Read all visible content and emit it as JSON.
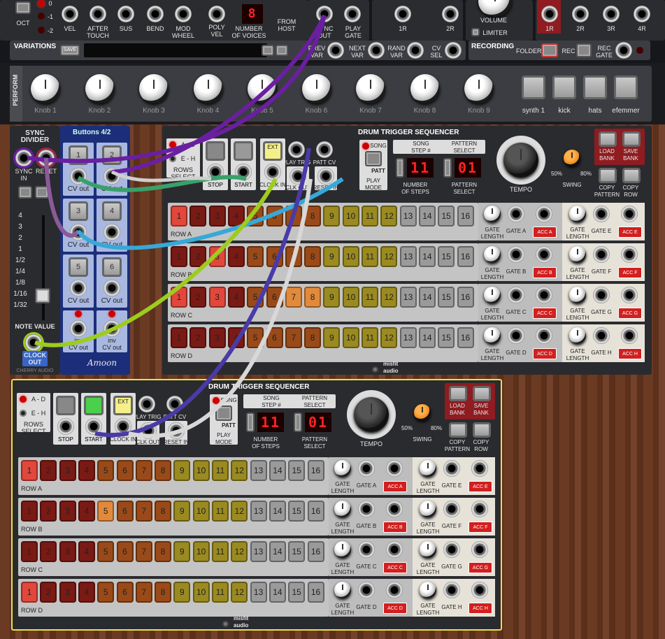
{
  "colors": {
    "cable_purple": "#6a1fa0",
    "cable_green": "#3aa06a",
    "cable_grey": "#cfcfcf",
    "cable_lime": "#9dcc1e",
    "cable_blue": "#37a8d8",
    "cable_indigo": "#4a3aa8",
    "step_red": "#e2473c",
    "step_dark": "#7a1a14",
    "step_brown": "#9a4a18",
    "step_olive": "#9a8a20",
    "step_yellow_lt": "#eee8a8",
    "step_grey": "#9a9a9a",
    "module_yellow_border": "#e8e24a"
  },
  "top": {
    "oct": {
      "label": "OCT",
      "values": [
        "0",
        "-1",
        "-2"
      ]
    },
    "jacks": [
      "VEL",
      "AFTER\nTOUCH",
      "SUS",
      "BEND",
      "MOD\nWHEEL"
    ],
    "poly": {
      "poly_vel": "POLY\nVEL",
      "voices_label": "NUMBER\nOF VOICES",
      "voices_value": "8"
    },
    "from_host": "FROM\nHOST",
    "sync_out": "SYNC\nOUT",
    "play_gate": "PLAY\nGATE",
    "r_labels": [
      "1R",
      "2R"
    ],
    "volume": "VOLUME",
    "limiter": "LIMITER",
    "out_labels": [
      "1R",
      "2R",
      "3R",
      "4R"
    ]
  },
  "variations": {
    "title": "VARIATIONS",
    "save": "SAVE",
    "prev": "PREV\nVAR",
    "next": "NEXT\nVAR",
    "rand": "RAND\nVAR",
    "cv": "CV\nSEL"
  },
  "recording": {
    "title": "RECORDING",
    "folder": "FOLDER",
    "rec": "REC",
    "rec_gate": "REC\nGATE"
  },
  "perform": {
    "side": "PERFORM",
    "knobs": [
      "Knob 1",
      "Knob 2",
      "Knob 3",
      "Knob 4",
      "Knob 5",
      "Knob 6",
      "Knob 7",
      "Knob 8",
      "Knob 9"
    ],
    "buttons": [
      "synth 1",
      "kick",
      "hats",
      "efemmer"
    ]
  },
  "sync_divider": {
    "title": "SYNC\nDIVIDER",
    "sync_in": "SYNC\nIN",
    "reset": "RESET",
    "note_value": "NOTE VALUE",
    "clock_out": "CLOCK\nOUT",
    "brand": "CHERRY AUDIO",
    "ticks": [
      "4",
      "3",
      "2",
      "1",
      "1/2",
      "1/4",
      "1/8",
      "1/16",
      "1/32"
    ]
  },
  "buttons_module": {
    "title": "Buttons 4/2",
    "buttons": [
      "1",
      "2",
      "3",
      "4",
      "5",
      "6"
    ],
    "cv_out": "CV out",
    "inv": "inv",
    "brand": "Amoon"
  },
  "seq1": {
    "title": "DRUM TRIGGER SEQUENCER",
    "rows_select": "ROWS\nSELECT",
    "a_d": "A - D",
    "e_h": "E - H",
    "stop": "STOP",
    "start": "START",
    "ext": "EXT",
    "clock_in": "CLOCK IN",
    "play_trig": "PLAY TRIG",
    "clk_out": "CLK OUT",
    "patt_cv": "PATT CV",
    "reset_in": "RESET IN",
    "song": "SONG",
    "patt": "PATT",
    "play_mode": "PLAY\nMODE",
    "song_step": "SONG\nSTEP #",
    "steps_value": "11",
    "number_of_steps": "NUMBER\nOF STEPS",
    "pattern_select_top": "PATTERN\nSELECT",
    "pattern_value": "01",
    "pattern_select": "PATTERN\nSELECT",
    "tempo": "TEMPO",
    "swing": "SWING",
    "swing_min": "50%",
    "swing_max": "80%",
    "load_bank": "LOAD\nBANK",
    "save_bank": "SAVE\nBANK",
    "copy_pattern": "COPY\nPATTERN",
    "copy_row": "COPY\nROW",
    "gate_length": "GATE\nLENGTH",
    "rows": [
      {
        "name": "ROW A",
        "gate": "GATE A",
        "acc": "ACC A",
        "gate2": "GATE E",
        "acc2": "ACC E",
        "active": [
          1
        ]
      },
      {
        "name": "ROW B",
        "gate": "GATE B",
        "acc": "ACC B",
        "gate2": "GATE F",
        "acc2": "ACC F",
        "active": [
          3
        ]
      },
      {
        "name": "ROW C",
        "gate": "GATE C",
        "acc": "ACC C",
        "gate2": "GATE G",
        "acc2": "ACC G",
        "active": [
          1,
          3,
          7,
          8
        ]
      },
      {
        "name": "ROW D",
        "gate": "GATE D",
        "acc": "ACC D",
        "gate2": "GATE H",
        "acc2": "ACC H",
        "active": []
      }
    ],
    "brand": "misfit\naudio"
  },
  "seq2": {
    "title": "DRUM TRIGGER SEQUENCER",
    "rows": [
      {
        "name": "ROW A",
        "gate": "GATE A",
        "acc": "ACC A",
        "gate2": "GATE E",
        "acc2": "ACC E",
        "active": [
          1
        ]
      },
      {
        "name": "ROW B",
        "gate": "GATE B",
        "acc": "ACC B",
        "gate2": "GATE F",
        "acc2": "ACC F",
        "active": [
          5
        ]
      },
      {
        "name": "ROW C",
        "gate": "GATE C",
        "acc": "ACC C",
        "gate2": "GATE G",
        "acc2": "ACC G",
        "active": []
      },
      {
        "name": "ROW D",
        "gate": "GATE D",
        "acc": "ACC D",
        "gate2": "GATE H",
        "acc2": "ACC H",
        "active": [
          1
        ]
      }
    ]
  }
}
